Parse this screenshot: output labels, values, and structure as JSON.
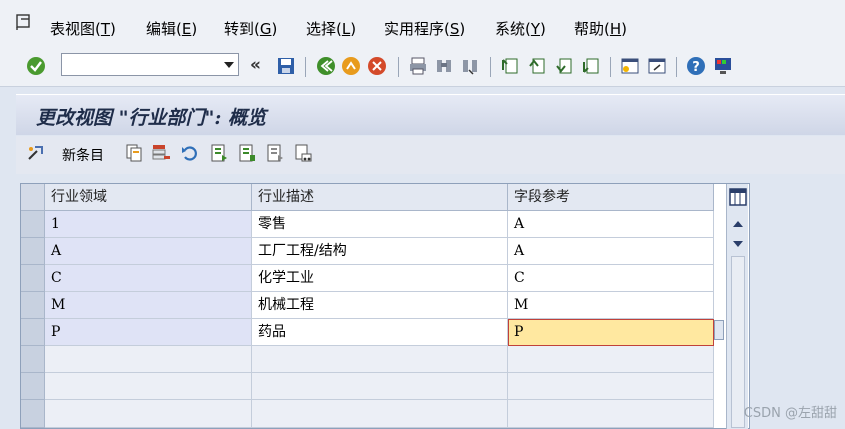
{
  "menubar": {
    "items": [
      {
        "text": "表视图(",
        "key": "T",
        "end": ")"
      },
      {
        "text": "编辑(",
        "key": "E",
        "end": ")"
      },
      {
        "text": "转到(",
        "key": "G",
        "end": ")"
      },
      {
        "text": "选择(",
        "key": "L",
        "end": ")"
      },
      {
        "text": "实用程序(",
        "key": "S",
        "end": ")"
      },
      {
        "text": "系统(",
        "key": "Y",
        "end": ")"
      },
      {
        "text": "帮助(",
        "key": "H",
        "end": ")"
      }
    ]
  },
  "toolbar": {
    "command_field_value": "",
    "back_arrows": "«"
  },
  "title": {
    "text": "更改视图 \"行业部门\": 概览"
  },
  "app_toolbar": {
    "new_entries_label": "新条目"
  },
  "table": {
    "headers": [
      "行业领域",
      "行业描述",
      "字段参考"
    ],
    "rows": [
      {
        "sector": "1",
        "description": "零售",
        "field_ref": "A"
      },
      {
        "sector": "A",
        "description": "工厂工程/结构",
        "field_ref": "A"
      },
      {
        "sector": "C",
        "description": "化学工业",
        "field_ref": "C"
      },
      {
        "sector": "M",
        "description": "机械工程",
        "field_ref": "M"
      },
      {
        "sector": "P",
        "description": "药品",
        "field_ref": "P"
      }
    ]
  },
  "watermark": "CSDN @左甜甜",
  "colors": {
    "accent_header": "#e3e8f2",
    "focused_cell": "#ffe8a0"
  }
}
